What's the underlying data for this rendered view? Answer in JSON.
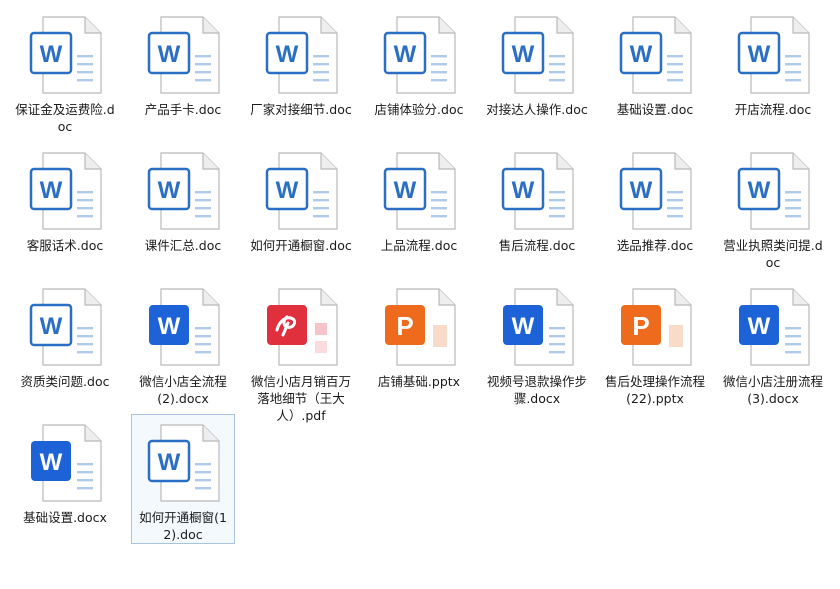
{
  "files": [
    {
      "name": "保证金及运费险.doc",
      "type": "doc",
      "selected": false
    },
    {
      "name": "产品手卡.doc",
      "type": "doc",
      "selected": false
    },
    {
      "name": "厂家对接细节.doc",
      "type": "doc",
      "selected": false
    },
    {
      "name": "店铺体验分.doc",
      "type": "doc",
      "selected": false
    },
    {
      "name": "对接达人操作.doc",
      "type": "doc",
      "selected": false
    },
    {
      "name": "基础设置.doc",
      "type": "doc",
      "selected": false
    },
    {
      "name": "开店流程.doc",
      "type": "doc",
      "selected": false
    },
    {
      "name": "客服话术.doc",
      "type": "doc",
      "selected": false
    },
    {
      "name": "课件汇总.doc",
      "type": "doc",
      "selected": false
    },
    {
      "name": "如何开通橱窗.doc",
      "type": "doc",
      "selected": false
    },
    {
      "name": "上品流程.doc",
      "type": "doc",
      "selected": false
    },
    {
      "name": "售后流程.doc",
      "type": "doc",
      "selected": false
    },
    {
      "name": "选品推荐.doc",
      "type": "doc",
      "selected": false
    },
    {
      "name": "营业执照类问提.doc",
      "type": "doc",
      "selected": false
    },
    {
      "name": "资质类问题.doc",
      "type": "doc",
      "selected": false
    },
    {
      "name": "微信小店全流程(2).docx",
      "type": "docx",
      "selected": false
    },
    {
      "name": "微信小店月销百万落地细节（王大人）.pdf",
      "type": "pdf",
      "selected": false
    },
    {
      "name": "店铺基础.pptx",
      "type": "pptx",
      "selected": false
    },
    {
      "name": "视频号退款操作步骤.docx",
      "type": "docx",
      "selected": false
    },
    {
      "name": "售后处理操作流程(22).pptx",
      "type": "pptx",
      "selected": false
    },
    {
      "name": "微信小店注册流程(3).docx",
      "type": "docx",
      "selected": false
    },
    {
      "name": "基础设置.docx",
      "type": "docx",
      "selected": false
    },
    {
      "name": "如何开通橱窗(12).doc",
      "type": "doc",
      "selected": true
    }
  ],
  "colors": {
    "doc_blue": "#2b6fc4",
    "docx_blue": "#1e62d8",
    "pdf_red": "#e0303e",
    "pptx_orange": "#ee6a1c",
    "selection_border": "#a8c4e0"
  },
  "icon_names": {
    "doc": "word-doc-icon",
    "docx": "word-docx-icon",
    "pdf": "pdf-icon",
    "pptx": "powerpoint-icon"
  }
}
